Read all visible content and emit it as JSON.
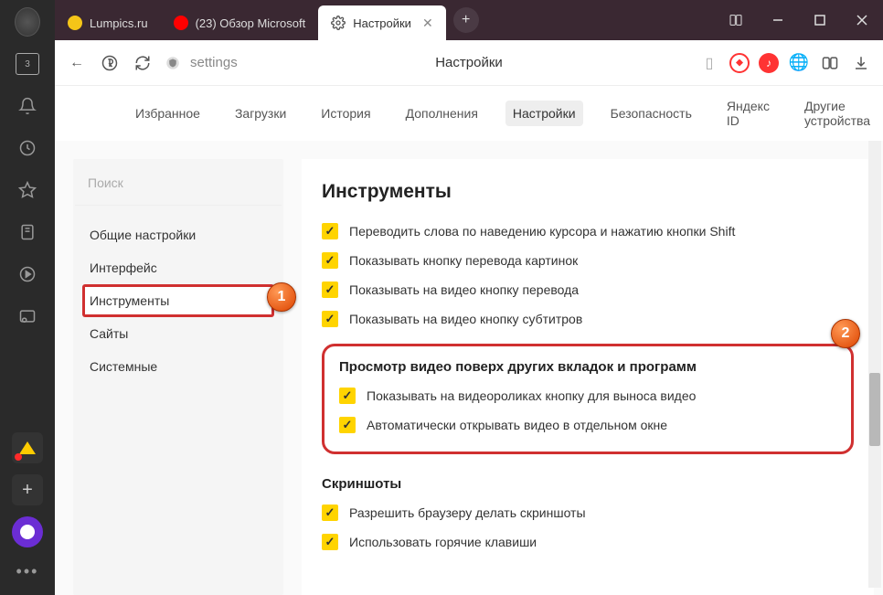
{
  "sidebar": {
    "home_badge": "3"
  },
  "tabs": [
    {
      "label": "Lumpics.ru",
      "icon_color": "#f5c518"
    },
    {
      "label": "(23) Обзор Microsoft",
      "icon_color": "#ff0000"
    },
    {
      "label": "Настройки",
      "active": true
    }
  ],
  "addressbar": {
    "url_text": "settings",
    "page_title": "Настройки"
  },
  "settings_nav": [
    "Избранное",
    "Загрузки",
    "История",
    "Дополнения",
    "Настройки",
    "Безопасность",
    "Яндекс ID",
    "Другие устройства"
  ],
  "settings_nav_active_index": 4,
  "left_panel": {
    "search_placeholder": "Поиск",
    "items": [
      "Общие настройки",
      "Интерфейс",
      "Инструменты",
      "Сайты",
      "Системные"
    ],
    "highlighted_index": 2
  },
  "content": {
    "title": "Инструменты",
    "group1": [
      "Переводить слова по наведению курсора и нажатию кнопки Shift",
      "Показывать кнопку перевода картинок",
      "Показывать на видео кнопку перевода",
      "Показывать на видео кнопку субтитров"
    ],
    "video_section": {
      "title": "Просмотр видео поверх других вкладок и программ",
      "items": [
        "Показывать на видеороликах кнопку для выноса видео",
        "Автоматически открывать видео в отдельном окне"
      ]
    },
    "screenshots": {
      "title": "Скриншоты",
      "items": [
        "Разрешить браузеру делать скриншоты",
        "Использовать горячие клавиши"
      ]
    }
  },
  "markers": {
    "1": "1",
    "2": "2"
  }
}
